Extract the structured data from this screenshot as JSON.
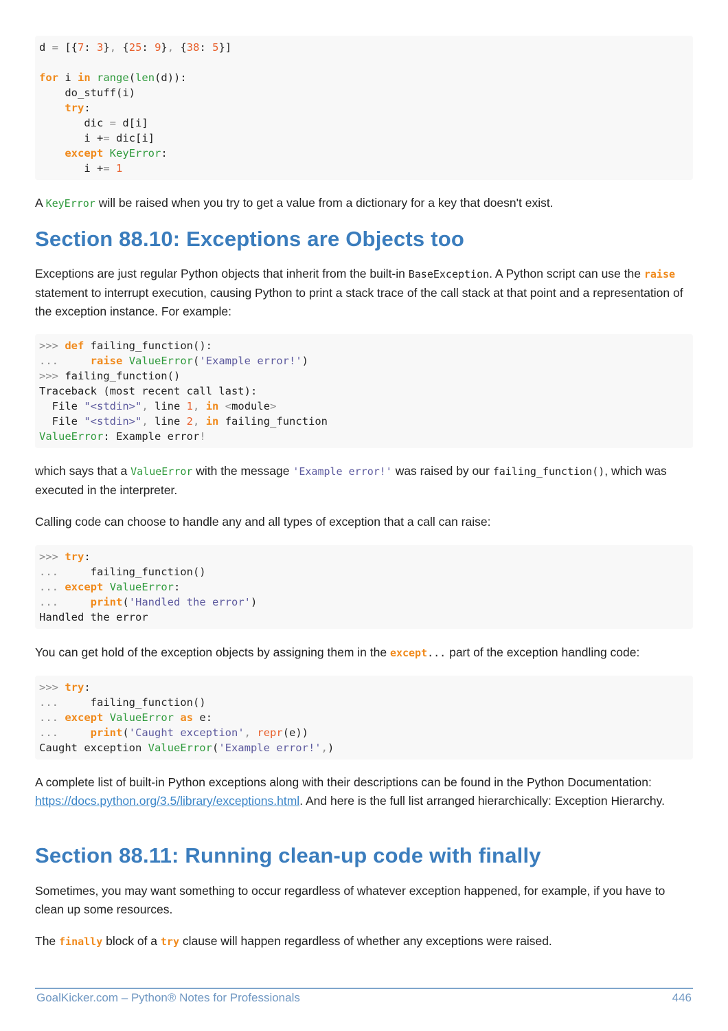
{
  "blocks": [
    {
      "type": "code",
      "name": "code-block-keyerror-loop",
      "lines": [
        [
          [
            "p",
            "d "
          ],
          [
            "op",
            "="
          ],
          [
            "p",
            " [{"
          ],
          [
            "num",
            "7"
          ],
          [
            "p",
            ": "
          ],
          [
            "num",
            "3"
          ],
          [
            "p",
            "}"
          ],
          [
            "op",
            ","
          ],
          [
            "p",
            " {"
          ],
          [
            "num",
            "25"
          ],
          [
            "p",
            ": "
          ],
          [
            "num",
            "9"
          ],
          [
            "p",
            "}"
          ],
          [
            "op",
            ","
          ],
          [
            "p",
            " {"
          ],
          [
            "num",
            "38"
          ],
          [
            "p",
            ": "
          ],
          [
            "num",
            "5"
          ],
          [
            "p",
            "}]"
          ]
        ],
        [],
        [
          [
            "kw",
            "for"
          ],
          [
            "p",
            " i "
          ],
          [
            "kw",
            "in"
          ],
          [
            "p",
            " "
          ],
          [
            "fn",
            "range"
          ],
          [
            "p",
            "("
          ],
          [
            "fn",
            "len"
          ],
          [
            "p",
            "(d)):"
          ]
        ],
        [
          [
            "p",
            "    do_stuff(i)"
          ]
        ],
        [
          [
            "p",
            "    "
          ],
          [
            "kw",
            "try"
          ],
          [
            "p",
            ":"
          ]
        ],
        [
          [
            "p",
            "       dic "
          ],
          [
            "op",
            "="
          ],
          [
            "p",
            " d[i]"
          ]
        ],
        [
          [
            "p",
            "       i +"
          ],
          [
            "op",
            "="
          ],
          [
            "p",
            " dic[i]"
          ]
        ],
        [
          [
            "p",
            "    "
          ],
          [
            "kw",
            "except"
          ],
          [
            "p",
            " "
          ],
          [
            "fn",
            "KeyError"
          ],
          [
            "p",
            ":"
          ]
        ],
        [
          [
            "p",
            "       i +"
          ],
          [
            "op",
            "="
          ],
          [
            "p",
            " "
          ],
          [
            "num",
            "1"
          ]
        ]
      ]
    },
    {
      "type": "para",
      "name": "paragraph-keyerror",
      "segs": [
        [
          "t",
          "A "
        ],
        [
          "ic fn",
          "KeyError"
        ],
        [
          "t",
          " will be raised when you try to get a value from a dictionary for a key that doesn't exist."
        ]
      ]
    },
    {
      "type": "head",
      "name": "section-heading-88-10",
      "text": "Section 88.10: Exceptions are Objects too"
    },
    {
      "type": "para",
      "name": "paragraph-exceptions-objects",
      "segs": [
        [
          "t",
          "Exceptions are just regular Python objects that inherit from the built-in "
        ],
        [
          "ic",
          "BaseException"
        ],
        [
          "t",
          ". A Python script can use the "
        ],
        [
          "ic kw",
          "raise"
        ],
        [
          "t",
          " statement to interrupt execution, causing Python to print a stack trace of the call stack at that point and a representation of the exception instance. For example:"
        ]
      ]
    },
    {
      "type": "code",
      "name": "code-block-failing-function",
      "lines": [
        [
          [
            "op",
            ">>>"
          ],
          [
            "p",
            " "
          ],
          [
            "kw",
            "def"
          ],
          [
            "p",
            " failing_function():"
          ]
        ],
        [
          [
            "op",
            "..."
          ],
          [
            "p",
            "     "
          ],
          [
            "kw",
            "raise"
          ],
          [
            "p",
            " "
          ],
          [
            "fn",
            "ValueError"
          ],
          [
            "p",
            "("
          ],
          [
            "str",
            "'Example error!'"
          ],
          [
            "p",
            ")"
          ]
        ],
        [
          [
            "op",
            ">>>"
          ],
          [
            "p",
            " failing_function()"
          ]
        ],
        [
          [
            "p",
            "Traceback (most recent call last):"
          ]
        ],
        [
          [
            "p",
            "  File "
          ],
          [
            "str",
            "\"<stdin>\""
          ],
          [
            "op",
            ","
          ],
          [
            "p",
            " line "
          ],
          [
            "num",
            "1"
          ],
          [
            "op",
            ","
          ],
          [
            "p",
            " "
          ],
          [
            "kw",
            "in"
          ],
          [
            "p",
            " "
          ],
          [
            "op",
            "<"
          ],
          [
            "p",
            "module"
          ],
          [
            "op",
            ">"
          ]
        ],
        [
          [
            "p",
            "  File "
          ],
          [
            "str",
            "\"<stdin>\""
          ],
          [
            "op",
            ","
          ],
          [
            "p",
            " line "
          ],
          [
            "num",
            "2"
          ],
          [
            "op",
            ","
          ],
          [
            "p",
            " "
          ],
          [
            "kw",
            "in"
          ],
          [
            "p",
            " failing_function"
          ]
        ],
        [
          [
            "fn",
            "ValueError"
          ],
          [
            "p",
            ": Example error"
          ],
          [
            "op",
            "!"
          ]
        ]
      ]
    },
    {
      "type": "para",
      "name": "paragraph-which-says",
      "segs": [
        [
          "t",
          "which says that a "
        ],
        [
          "ic fn",
          "ValueError"
        ],
        [
          "t",
          " with the message "
        ],
        [
          "ic str",
          "'Example error!'"
        ],
        [
          "t",
          " was raised by our "
        ],
        [
          "ic",
          "failing_function()"
        ],
        [
          "t",
          ", which was executed in the interpreter."
        ]
      ]
    },
    {
      "type": "para",
      "name": "paragraph-calling-code",
      "segs": [
        [
          "t",
          "Calling code can choose to handle any and all types of exception that a call can raise:"
        ]
      ]
    },
    {
      "type": "code",
      "name": "code-block-handle-error",
      "lines": [
        [
          [
            "op",
            ">>>"
          ],
          [
            "p",
            " "
          ],
          [
            "kw",
            "try"
          ],
          [
            "p",
            ":"
          ]
        ],
        [
          [
            "op",
            "..."
          ],
          [
            "p",
            "     failing_function()"
          ]
        ],
        [
          [
            "op",
            "..."
          ],
          [
            "p",
            " "
          ],
          [
            "kw",
            "except"
          ],
          [
            "p",
            " "
          ],
          [
            "fn",
            "ValueError"
          ],
          [
            "p",
            ":"
          ]
        ],
        [
          [
            "op",
            "..."
          ],
          [
            "p",
            "     "
          ],
          [
            "kw",
            "print"
          ],
          [
            "p",
            "("
          ],
          [
            "str",
            "'Handled the error'"
          ],
          [
            "p",
            ")"
          ]
        ],
        [
          [
            "p",
            "Handled the error"
          ]
        ]
      ]
    },
    {
      "type": "para",
      "name": "paragraph-get-hold",
      "segs": [
        [
          "t",
          "You can get hold of the exception objects by assigning them in the "
        ],
        [
          "ic kw",
          "except"
        ],
        [
          "ic",
          "..."
        ],
        [
          "t",
          " part of the exception handling code:"
        ]
      ]
    },
    {
      "type": "code",
      "name": "code-block-caught-exception",
      "lines": [
        [
          [
            "op",
            ">>>"
          ],
          [
            "p",
            " "
          ],
          [
            "kw",
            "try"
          ],
          [
            "p",
            ":"
          ]
        ],
        [
          [
            "op",
            "..."
          ],
          [
            "p",
            "     failing_function()"
          ]
        ],
        [
          [
            "op",
            "..."
          ],
          [
            "p",
            " "
          ],
          [
            "kw",
            "except"
          ],
          [
            "p",
            " "
          ],
          [
            "fn",
            "ValueError"
          ],
          [
            "p",
            " "
          ],
          [
            "kw",
            "as"
          ],
          [
            "p",
            " e:"
          ]
        ],
        [
          [
            "op",
            "..."
          ],
          [
            "p",
            "     "
          ],
          [
            "kw",
            "print"
          ],
          [
            "p",
            "("
          ],
          [
            "str",
            "'Caught exception'"
          ],
          [
            "op",
            ","
          ],
          [
            "p",
            " "
          ],
          [
            "num",
            "repr"
          ],
          [
            "p",
            "(e))"
          ]
        ],
        [
          [
            "p",
            "Caught exception "
          ],
          [
            "fn",
            "ValueError"
          ],
          [
            "p",
            "("
          ],
          [
            "str",
            "'Example error!'"
          ],
          [
            "op",
            ","
          ],
          [
            "p",
            ")"
          ]
        ]
      ]
    },
    {
      "type": "para",
      "name": "paragraph-complete-list",
      "segs": [
        [
          "t",
          "A complete list of built-in Python exceptions along with their descriptions can be found in the Python Documentation: "
        ],
        [
          "link",
          "https://docs.python.org/3.5/library/exceptions.html"
        ],
        [
          "t",
          ". And here is the full list arranged hierarchically: Exception Hierarchy."
        ]
      ]
    },
    {
      "type": "head",
      "name": "section-heading-88-11",
      "text": "Section 88.11: Running clean-up code with finally"
    },
    {
      "type": "para",
      "name": "paragraph-sometimes",
      "segs": [
        [
          "t",
          "Sometimes, you may want something to occur regardless of whatever exception happened, for example, if you have to clean up some resources."
        ]
      ]
    },
    {
      "type": "para",
      "name": "paragraph-finally-block",
      "segs": [
        [
          "t",
          "The "
        ],
        [
          "ic kw",
          "finally"
        ],
        [
          "t",
          " block of a "
        ],
        [
          "ic kw",
          "try"
        ],
        [
          "t",
          " clause will happen regardless of whether any exceptions were raised."
        ]
      ]
    }
  ],
  "footer": {
    "left": "GoalKicker.com – Python® Notes for Professionals",
    "page": "446"
  },
  "colors": {
    "heading": "#3b7dbd",
    "keyword": "#f08a1c",
    "builtin": "#2f9a3c",
    "string": "#5d5a9e",
    "number": "#e8602c",
    "link": "#3b86c8",
    "footer": "#6f97c2"
  }
}
